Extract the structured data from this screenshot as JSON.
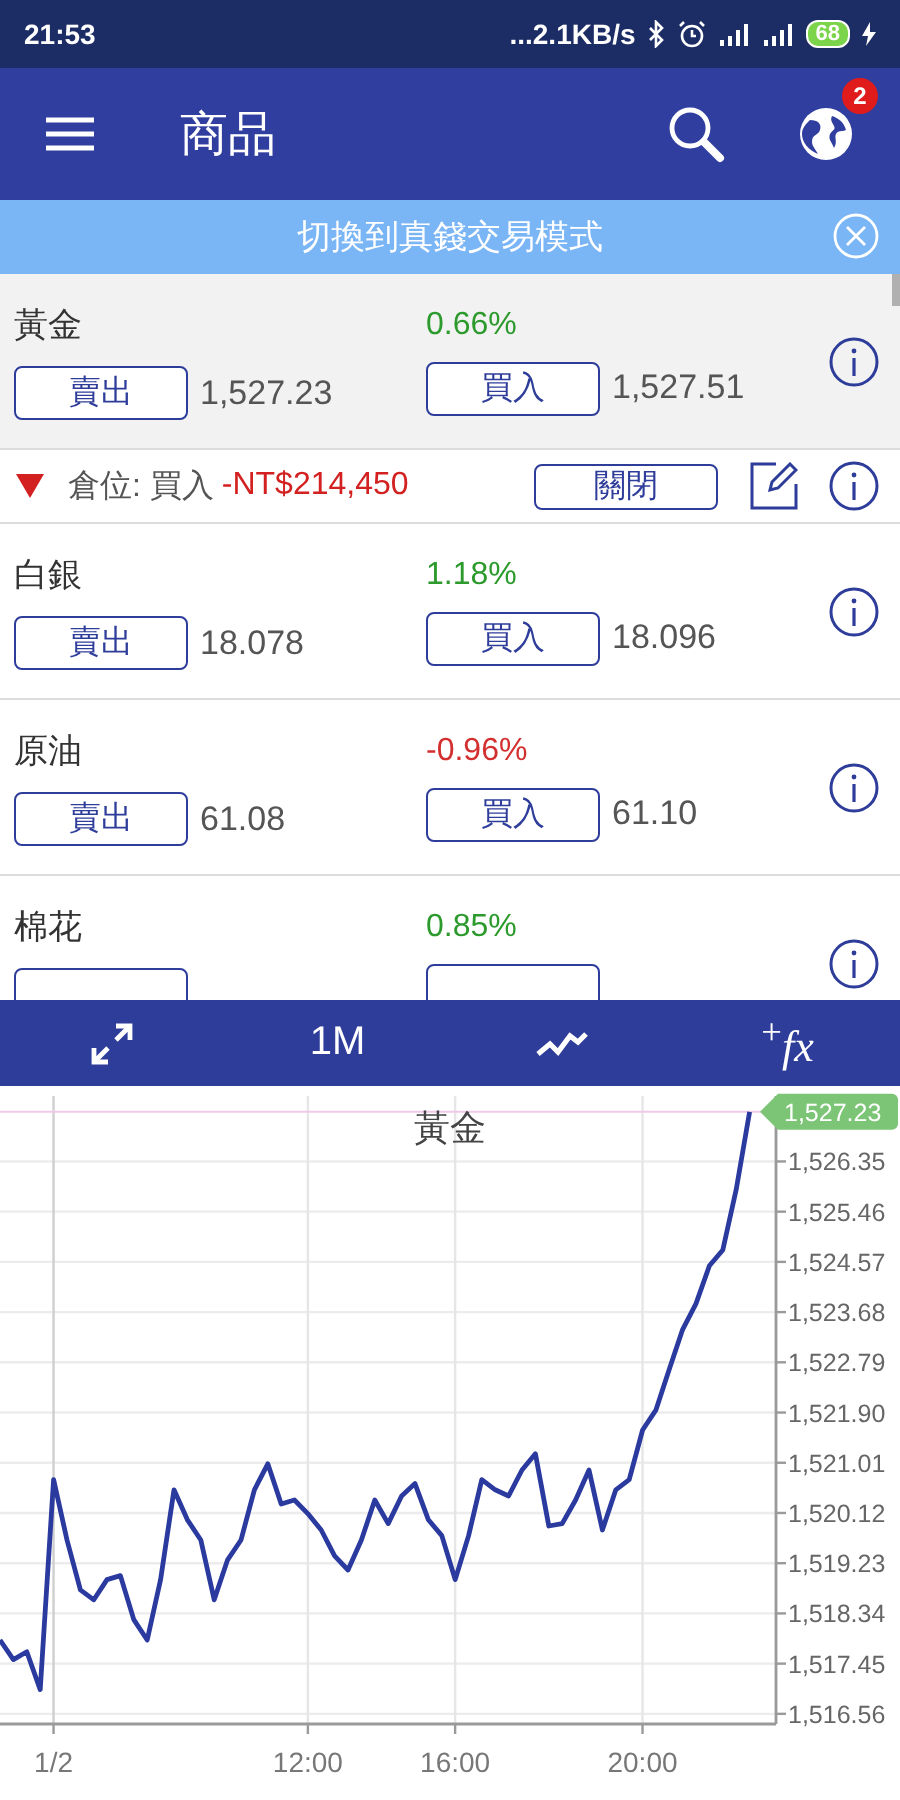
{
  "status_bar": {
    "time": "21:53",
    "network": "...2.1KB/s",
    "battery": "68"
  },
  "app_bar": {
    "title": "商品",
    "badge": "2"
  },
  "banner": {
    "text": "切換到真錢交易模式"
  },
  "instruments": [
    {
      "name": "黃金",
      "change": "0.66%",
      "color": "#2c9a2c",
      "selected": true,
      "sell_label": "賣出",
      "sell": "1,527.23",
      "buy_label": "買入",
      "buy": "1,527.51",
      "position": {
        "side": "倉位: 買入",
        "pnl": "-NT$214,450",
        "close_label": "關閉"
      }
    },
    {
      "name": "白銀",
      "change": "1.18%",
      "color": "#2c9a2c",
      "selected": false,
      "sell_label": "賣出",
      "sell": "18.078",
      "buy_label": "買入",
      "buy": "18.096"
    },
    {
      "name": "原油",
      "change": "-0.96%",
      "color": "#d32f2f",
      "selected": false,
      "sell_label": "賣出",
      "sell": "61.08",
      "buy_label": "買入",
      "buy": "61.10"
    },
    {
      "name": "棉花",
      "change": "0.85%",
      "color": "#2c9a2c",
      "selected": false
    }
  ],
  "chart_toolbar": {
    "period": "1M",
    "indicator": "$^{+}$*fx*"
  },
  "chart": {
    "chart_data": {
      "type": "line",
      "title": "黃金",
      "grid": true,
      "ref_lines": [
        {
          "axis": "y",
          "value": 1527.23,
          "color": "#f0c8e8",
          "label": "1,527.23"
        }
      ],
      "categories": [
        null,
        null,
        null,
        null,
        "1/2",
        null,
        null,
        null,
        null,
        null,
        null,
        null,
        null,
        null,
        null,
        null,
        null,
        null,
        null,
        null,
        null,
        null,
        null,
        "12:00",
        null,
        null,
        null,
        null,
        null,
        null,
        null,
        null,
        null,
        null,
        "16:00",
        null,
        null,
        null,
        null,
        null,
        null,
        null,
        null,
        null,
        null,
        null,
        null,
        null,
        "20:00",
        null,
        null,
        null,
        null,
        null,
        null,
        null,
        null
      ],
      "series": [
        {
          "color": "#2b3a9e",
          "values": [
            1517.87,
            1517.52,
            1517.66,
            1516.99,
            1520.71,
            1519.64,
            1518.76,
            1518.58,
            1518.94,
            1519.01,
            1518.23,
            1517.87,
            1518.94,
            1520.53,
            1520.0,
            1519.64,
            1518.58,
            1519.29,
            1519.64,
            1520.53,
            1520.99,
            1520.28,
            1520.35,
            1520.11,
            1519.82,
            1519.36,
            1519.11,
            1519.64,
            1520.35,
            1519.93,
            1520.42,
            1520.64,
            1520.0,
            1519.72,
            1518.94,
            1519.72,
            1520.71,
            1520.53,
            1520.42,
            1520.88,
            1521.17,
            1519.89,
            1519.93,
            1520.35,
            1520.88,
            1519.82,
            1520.53,
            1520.71,
            1521.59,
            1521.95,
            1522.66,
            1523.37,
            1523.83,
            1524.5,
            1524.78,
            1525.85,
            1527.23
          ]
        }
      ],
      "ylim": [
        1516.38,
        1527.51
      ],
      "yticks": [
        {
          "value": 1526.35,
          "label": "1,526.35"
        },
        {
          "value": 1525.46,
          "label": "1,525.46"
        },
        {
          "value": 1524.57,
          "label": "1,524.57"
        },
        {
          "value": 1523.68,
          "label": "1,523.68"
        },
        {
          "value": 1522.79,
          "label": "1,522.79"
        },
        {
          "value": 1521.9,
          "label": "1,521.90"
        },
        {
          "value": 1521.01,
          "label": "1,521.01"
        },
        {
          "value": 1520.12,
          "label": "1,520.12"
        },
        {
          "value": 1519.23,
          "label": "1,519.23"
        },
        {
          "value": 1518.34,
          "label": "1,518.34"
        },
        {
          "value": 1517.45,
          "label": "1,517.45"
        },
        {
          "value": 1516.56,
          "label": "1,516.56"
        }
      ]
    }
  }
}
